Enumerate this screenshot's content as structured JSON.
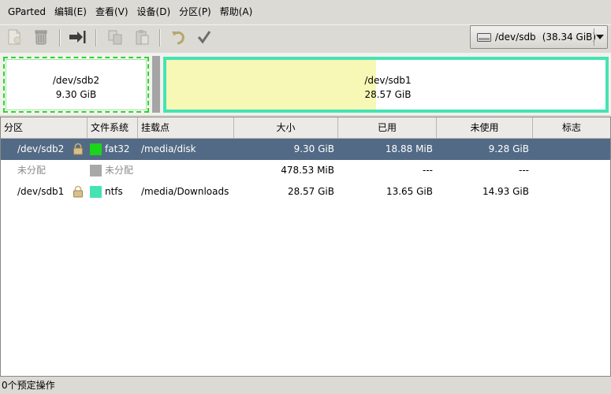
{
  "menu": [
    "GParted",
    "编辑(E)",
    "查看(V)",
    "设备(D)",
    "分区(P)",
    "帮助(A)"
  ],
  "toolbar": {
    "buttons": [
      {
        "name": "new-partition",
        "icon": "new-document-icon",
        "enabled": false
      },
      {
        "name": "delete-partition",
        "icon": "trash-icon",
        "enabled": false
      },
      {
        "name": "resize-move",
        "icon": "resize-arrow-icon",
        "enabled": true
      },
      {
        "name": "copy",
        "icon": "copy-icon",
        "enabled": false
      },
      {
        "name": "paste",
        "icon": "paste-icon",
        "enabled": false
      },
      {
        "name": "undo",
        "icon": "undo-icon",
        "enabled": false
      },
      {
        "name": "apply",
        "icon": "checkmark-icon",
        "enabled": false
      }
    ]
  },
  "device": {
    "name": "/dev/sdb",
    "size": "(38.34 GiB)",
    "icon": "hard-drive-icon"
  },
  "disk_map": {
    "sdb2": {
      "name": "/dev/sdb2",
      "size": "9.30 GiB",
      "color": "#2ad52a"
    },
    "sdb1": {
      "name": "/dev/sdb1",
      "size": "28.57 GiB",
      "color": "#45e3b3",
      "used_fraction": 0.478
    }
  },
  "table": {
    "headers": [
      "分区",
      "文件系统",
      "挂载点",
      "大小",
      "已用",
      "未使用",
      "标志"
    ],
    "rows": [
      {
        "partition": "/dev/sdb2",
        "locked": true,
        "fs": "fat32",
        "fs_color": "#1bd41b",
        "mount": "/media/disk",
        "size": "9.30 GiB",
        "used": "18.88 MiB",
        "unused": "9.28 GiB",
        "flags": "",
        "selected": true
      },
      {
        "partition": "未分配",
        "locked": false,
        "fs": "未分配",
        "fs_color": "#a8a8a8",
        "mount": "",
        "size": "478.53 MiB",
        "used": "---",
        "unused": "---",
        "flags": "",
        "selected": false,
        "dim": true
      },
      {
        "partition": "/dev/sdb1",
        "locked": true,
        "fs": "ntfs",
        "fs_color": "#45e3b3",
        "mount": "/media/Downloads",
        "size": "28.57 GiB",
        "used": "13.65 GiB",
        "unused": "14.93 GiB",
        "flags": "",
        "selected": false
      }
    ]
  },
  "status": "0个预定操作"
}
